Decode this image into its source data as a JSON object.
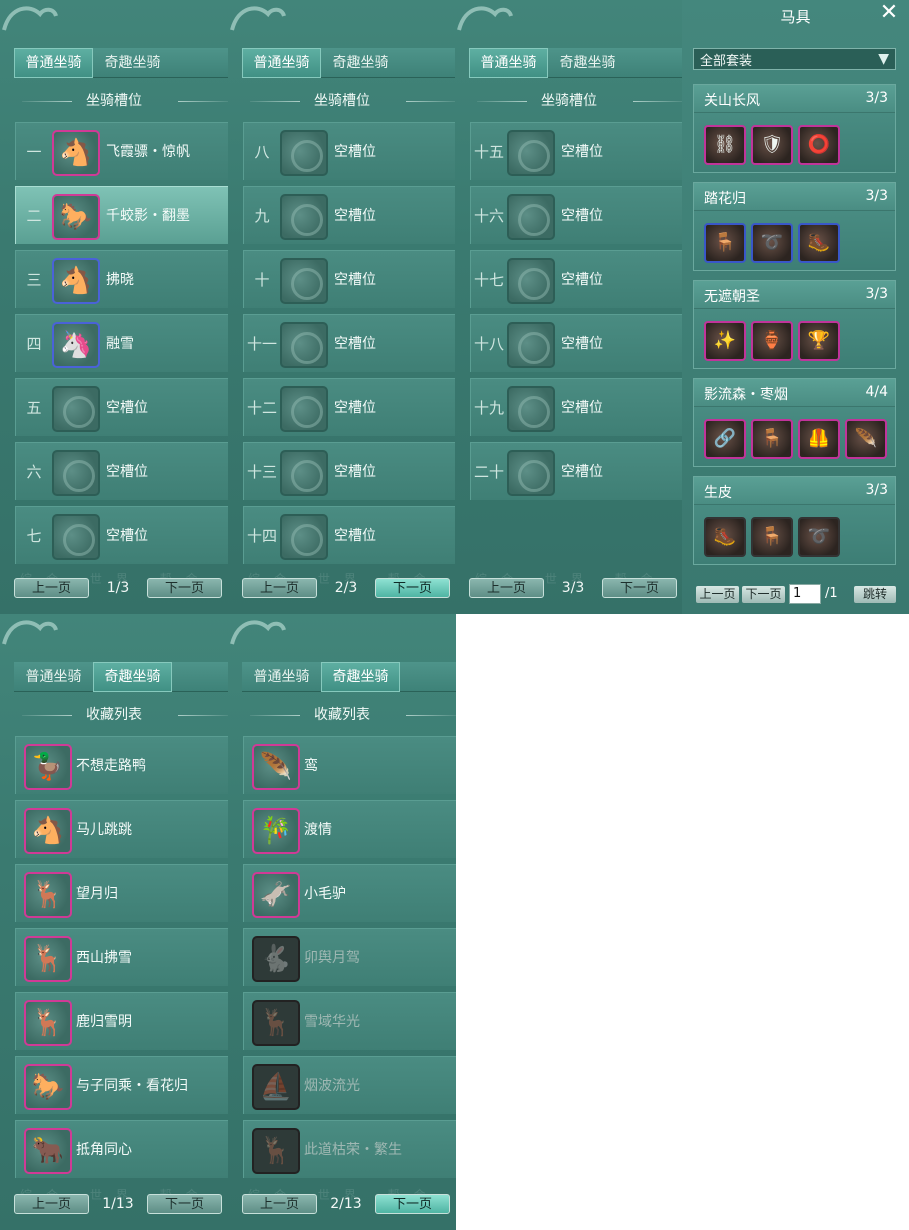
{
  "tabs": {
    "normal": "普通坐骑",
    "fun": "奇趣坐骑"
  },
  "sections": {
    "slots": "坐骑槽位",
    "collection": "收藏列表"
  },
  "pager": {
    "prev": "上一页",
    "next": "下一页"
  },
  "watermark": "综合 世界 帮会 阵营",
  "slot_pages": [
    {
      "page": "1/3",
      "rows": [
        {
          "num": "一",
          "name": "飞霞骠・惊帆",
          "icon": "white-horse-icon",
          "frame": "pink",
          "glyph": "🐴"
        },
        {
          "num": "二",
          "name": "千蛟影・翻墨",
          "icon": "black-horse-icon",
          "frame": "pink",
          "glyph": "🐎"
        },
        {
          "num": "三",
          "name": "拂晓",
          "icon": "chestnut-horse-icon",
          "frame": "blue",
          "glyph": "🐴"
        },
        {
          "num": "四",
          "name": "融雪",
          "icon": "snow-horse-icon",
          "frame": "blue",
          "glyph": "🦄"
        },
        {
          "num": "五",
          "name": "空槽位",
          "icon": "empty-slot-icon",
          "frame": "",
          "glyph": ""
        },
        {
          "num": "六",
          "name": "空槽位",
          "icon": "empty-slot-icon",
          "frame": "",
          "glyph": ""
        },
        {
          "num": "七",
          "name": "空槽位",
          "icon": "empty-slot-icon",
          "frame": "",
          "glyph": ""
        }
      ]
    },
    {
      "page": "2/3",
      "rows": [
        {
          "num": "八",
          "name": "空槽位"
        },
        {
          "num": "九",
          "name": "空槽位"
        },
        {
          "num": "十",
          "name": "空槽位"
        },
        {
          "num": "十一",
          "name": "空槽位"
        },
        {
          "num": "十二",
          "name": "空槽位"
        },
        {
          "num": "十三",
          "name": "空槽位"
        },
        {
          "num": "十四",
          "name": "空槽位"
        }
      ]
    },
    {
      "page": "3/3",
      "rows": [
        {
          "num": "十五",
          "name": "空槽位"
        },
        {
          "num": "十六",
          "name": "空槽位"
        },
        {
          "num": "十七",
          "name": "空槽位"
        },
        {
          "num": "十八",
          "name": "空槽位"
        },
        {
          "num": "十九",
          "name": "空槽位"
        },
        {
          "num": "二十",
          "name": "空槽位"
        }
      ]
    }
  ],
  "collection_pages": [
    {
      "page": "1/13",
      "rows": [
        {
          "name": "不想走路鸭",
          "icon": "duck-mount-icon",
          "glyph": "🦆",
          "owned": true
        },
        {
          "name": "马儿跳跳",
          "icon": "donkey-toy-icon",
          "glyph": "🐴",
          "owned": true
        },
        {
          "name": "望月归",
          "icon": "moon-deer-icon",
          "glyph": "🦌",
          "owned": true
        },
        {
          "name": "西山拂雪",
          "icon": "white-deer-icon",
          "glyph": "🦌",
          "owned": true
        },
        {
          "name": "鹿归雪明",
          "icon": "red-deer-icon",
          "glyph": "🦌",
          "owned": true
        },
        {
          "name": "与子同乘・看花归",
          "icon": "flower-horse-icon",
          "glyph": "🐎",
          "owned": true
        },
        {
          "name": "抵角同心",
          "icon": "horned-pair-icon",
          "glyph": "🐂",
          "owned": true
        }
      ]
    },
    {
      "page": "2/13",
      "rows": [
        {
          "name": "鸾",
          "icon": "phoenix-icon",
          "glyph": "🪶",
          "owned": true
        },
        {
          "name": "渡情",
          "icon": "bamboo-raft-icon",
          "glyph": "🎋",
          "owned": true
        },
        {
          "name": "小毛驴",
          "icon": "donkey-icon",
          "glyph": "🫏",
          "owned": true
        },
        {
          "name": "卯舆月驾",
          "icon": "rabbit-carriage-icon",
          "glyph": "🐇",
          "owned": false
        },
        {
          "name": "雪域华光",
          "icon": "snow-elk-icon",
          "glyph": "🦌",
          "owned": false
        },
        {
          "name": "烟波流光",
          "icon": "mist-boat-icon",
          "glyph": "⛵",
          "owned": false
        },
        {
          "name": "此道枯荣・繁生",
          "icon": "wither-deer-icon",
          "glyph": "🦌",
          "owned": false
        }
      ]
    }
  ],
  "gear": {
    "title": "马具",
    "filter": "全部套装",
    "sets": [
      {
        "name": "关山长风",
        "count": "3/3",
        "pieces": [
          {
            "icon": "bridle-icon",
            "frame": "p",
            "glyph": "⛓"
          },
          {
            "icon": "saddle-icon",
            "frame": "p",
            "glyph": "🛡"
          },
          {
            "icon": "stirrup-icon",
            "frame": "p",
            "glyph": "⭕"
          }
        ]
      },
      {
        "name": "踏花归",
        "count": "3/3",
        "pieces": [
          {
            "icon": "saddle-icon",
            "frame": "b",
            "glyph": "🪑"
          },
          {
            "icon": "bridle-icon",
            "frame": "b",
            "glyph": "➰"
          },
          {
            "icon": "leg-guard-icon",
            "frame": "b",
            "glyph": "🥾"
          }
        ]
      },
      {
        "name": "无遮朝圣",
        "count": "3/3",
        "pieces": [
          {
            "icon": "bridle-icon",
            "frame": "p",
            "glyph": "✨"
          },
          {
            "icon": "saddle-icon",
            "frame": "p",
            "glyph": "🏺"
          },
          {
            "icon": "leg-guard-icon",
            "frame": "p",
            "glyph": "🏆"
          }
        ]
      },
      {
        "name": "影流森・枣烟",
        "count": "4/4",
        "pieces": [
          {
            "icon": "bridle-icon",
            "frame": "p",
            "glyph": "🔗"
          },
          {
            "icon": "saddle-icon",
            "frame": "p",
            "glyph": "🪑"
          },
          {
            "icon": "armor-icon",
            "frame": "p",
            "glyph": "🦺"
          },
          {
            "icon": "plume-icon",
            "frame": "p",
            "glyph": "🪶"
          }
        ]
      },
      {
        "name": "生皮",
        "count": "3/3",
        "pieces": [
          {
            "icon": "leg-guard-icon",
            "frame": "",
            "glyph": "🥾"
          },
          {
            "icon": "saddle-icon",
            "frame": "",
            "glyph": "🪑"
          },
          {
            "icon": "bridle-icon",
            "frame": "",
            "glyph": "➰"
          }
        ]
      }
    ],
    "pager": {
      "prev": "上一页",
      "next": "下一页",
      "page": "1",
      "total": "/1",
      "jump": "跳转"
    }
  }
}
